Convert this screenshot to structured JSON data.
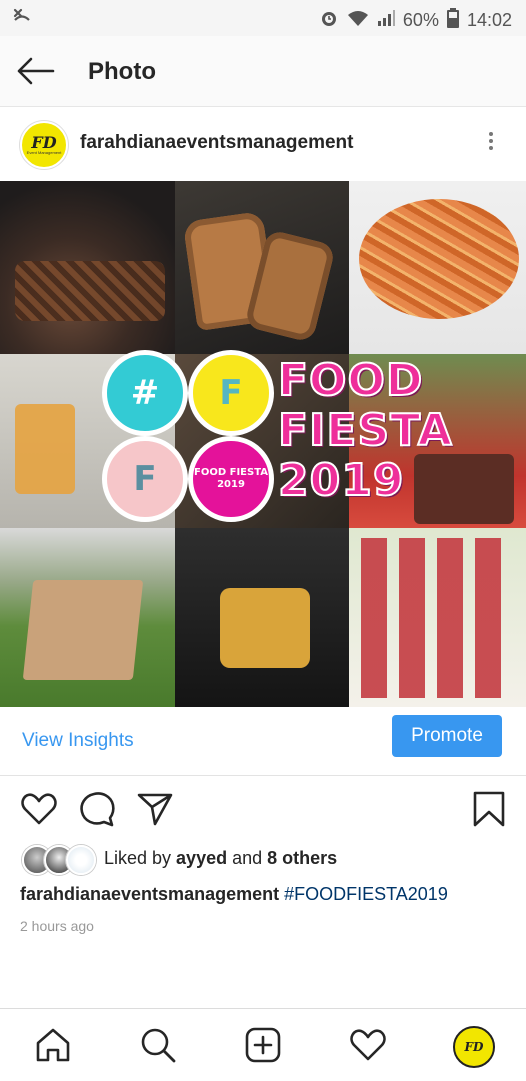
{
  "status_bar": {
    "left_icon": "notification-icon",
    "battery": "60%",
    "time": "14:02"
  },
  "header": {
    "title": "Photo"
  },
  "post": {
    "username": "farahdianaevents­management",
    "avatar_text": "FD",
    "avatar_subtext": "Event Management",
    "image": {
      "overlay_line1": "FOOD",
      "overlay_line2": "FIESTA",
      "overlay_line3": "2019",
      "bubble_hash": "#",
      "bubble_f1": "F",
      "bubble_f2": "F",
      "bubble_small": "FOOD FIESTA 2019"
    },
    "insights_label": "View Insights",
    "promote_label": "Promote",
    "likes_prefix": "Liked by ",
    "likes_user": "ayyed",
    "likes_and": " and ",
    "likes_others": "8 others",
    "caption_user": "farahdianaeventsmanagement",
    "caption_tag": "#FOODFIESTA2019",
    "time_ago": "2 hours ago"
  },
  "colors": {
    "accent": "#3897f0",
    "pink": "#ee2f9a",
    "teal": "#33cbd4",
    "yellow": "#f8e71c",
    "magenta": "#e4129a"
  }
}
